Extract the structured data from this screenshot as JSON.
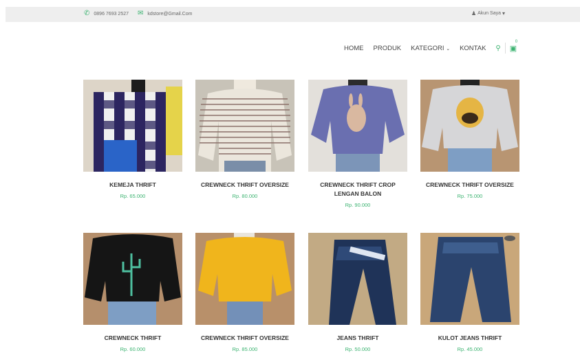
{
  "topbar": {
    "phone": "0896 7693 2527",
    "email": "kdstore@Gmail.Com",
    "account": "Akun Saya"
  },
  "nav": {
    "items": [
      "HOME",
      "PRODUK",
      "KATEGORI",
      "KONTAK"
    ],
    "cart_count": "0"
  },
  "products": [
    {
      "name": "KEMEJA THRIFT",
      "price": "Rp. 65.000"
    },
    {
      "name": "CREWNECK THRIFT OVERSIZE",
      "price": "Rp. 80.000"
    },
    {
      "name": "CREWNECK THRIFT CROP LENGAN BALON",
      "price": "Rp. 90.000"
    },
    {
      "name": "CREWNECK THRIFT OVERSIZE",
      "price": "Rp. 75.000"
    },
    {
      "name": "CREWNECK THRIFT",
      "price": "Rp. 60.000"
    },
    {
      "name": "CREWNECK THRIFT OVERSIZE",
      "price": "Rp. 85.000"
    },
    {
      "name": "JEANS THRIFT",
      "price": "Rp. 50.000"
    },
    {
      "name": "KULOT JEANS THRIFT",
      "price": "Rp. 45.000"
    }
  ],
  "colors": {
    "accent": "#3cb371"
  }
}
